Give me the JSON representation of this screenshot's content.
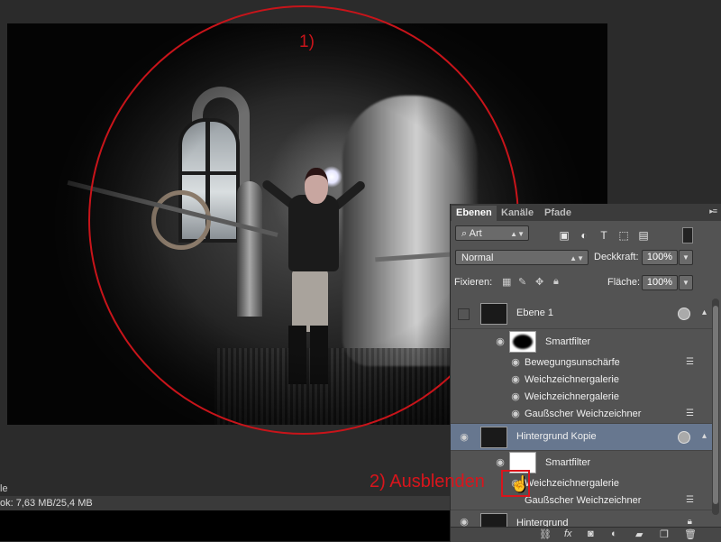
{
  "annotations": {
    "circle_label": "1)",
    "hide_label": "2) Ausblenden"
  },
  "status": {
    "fragment": "le",
    "doc_info": "ok: 7,63 MB/25,4 MB"
  },
  "layers_panel": {
    "tabs": [
      {
        "label": "Ebenen",
        "active": true
      },
      {
        "label": "Kanäle",
        "active": false
      },
      {
        "label": "Pfade",
        "active": false
      }
    ],
    "filter": {
      "value": "Art",
      "icon": "search-icon"
    },
    "filter_icons": [
      "image-filter-icon",
      "adjustment-filter-icon",
      "type-filter-icon",
      "shape-filter-icon",
      "smartobject-filter-icon"
    ],
    "blend_mode": "Normal",
    "opacity_label": "Deckkraft:",
    "opacity_value": "100%",
    "lock_label": "Fixieren:",
    "fill_label": "Fläche:",
    "fill_value": "100%",
    "layers": {
      "ebene1": {
        "name": "Ebene 1",
        "visible": false
      },
      "sf1": {
        "name": "Smartfilter"
      },
      "sf1_filters": [
        "Bewegungsunschärfe",
        "Weichzeichnergalerie",
        "Weichzeichnergalerie",
        "Gaußscher Weichzeichner"
      ],
      "kopie": {
        "name": "Hintergrund Kopie",
        "visible": true,
        "selected": true
      },
      "sf2": {
        "name": "Smartfilter"
      },
      "sf2_filters": [
        "Weichzeichnergalerie",
        "Gaußscher Weichzeichner"
      ],
      "bg": {
        "name": "Hintergrund",
        "visible": true,
        "locked": true
      }
    },
    "footer_icons": [
      "link-icon",
      "fx-icon",
      "mask-icon",
      "adjustment-icon",
      "folder-icon",
      "new-layer-icon",
      "trash-icon"
    ],
    "footer_fx": "fx"
  }
}
